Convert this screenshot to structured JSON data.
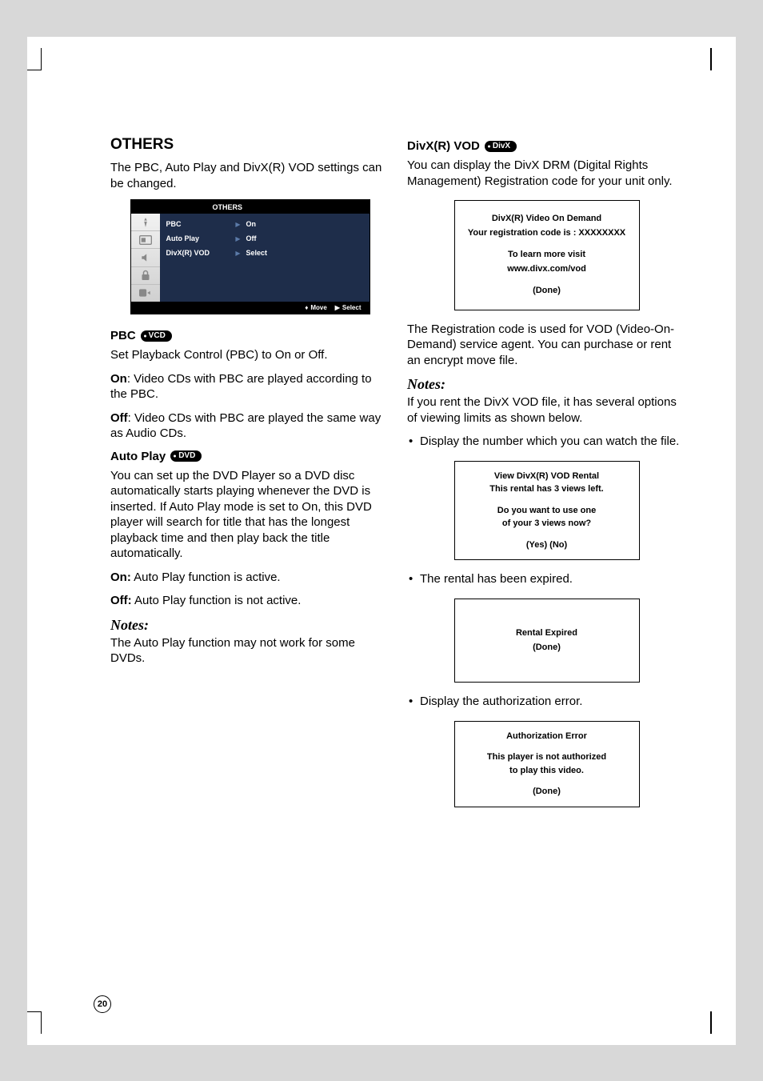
{
  "page_number": "20",
  "left": {
    "title": "OTHERS",
    "intro": "The PBC, Auto Play and DivX(R) VOD settings can be changed.",
    "osd": {
      "header": "OTHERS",
      "rows": [
        {
          "label": "PBC",
          "value": "On"
        },
        {
          "label": "Auto Play",
          "value": "Off"
        },
        {
          "label": "DivX(R) VOD",
          "value": "Select"
        }
      ],
      "footer_move": "Move",
      "footer_select": "Select"
    },
    "pbc": {
      "heading": "PBC",
      "badge": "VCD",
      "desc": "Set Playback Control (PBC) to On or Off.",
      "on_label": "On",
      "on_text": ": Video CDs with PBC are played according to the PBC.",
      "off_label": "Off",
      "off_text": ": Video CDs with PBC are played the same way as Audio CDs."
    },
    "autoplay": {
      "heading": "Auto Play",
      "badge": "DVD",
      "desc": "You can set up the DVD Player so a DVD disc automatically starts playing whenever the DVD is inserted. If Auto Play mode is set to On, this DVD player will search for title that has the longest playback time and then play back the title automatically.",
      "on_label": "On:",
      "on_text": " Auto Play function is active.",
      "off_label": "Off:",
      "off_text": " Auto Play function is not active."
    },
    "notes_heading": "Notes:",
    "notes_text": "The Auto Play function may not work for some DVDs."
  },
  "right": {
    "divx": {
      "heading": "DivX(R) VOD",
      "badge": "DivX",
      "intro": "You can display the DivX DRM (Digital Rights Management) Registration code for your unit only."
    },
    "reg_box": {
      "line1": "DivX(R) Video On Demand",
      "line2": "Your registration code is : XXXXXXXX",
      "line3": "To learn more visit",
      "line4": "www.divx.com/vod",
      "done": "(Done)"
    },
    "reg_text": "The Registration code is used for VOD (Video-On-Demand) service agent. You can purchase or rent an encrypt move file.",
    "notes_heading": "Notes:",
    "notes_text": "If you rent the DivX VOD file, it has several options of viewing limits as shown below.",
    "bullet1": "Display the number which you can watch the file.",
    "rental_box": {
      "line1": "View DivX(R) VOD Rental",
      "line2": "This rental has 3 views left.",
      "line3": "Do you want to use one",
      "line4": "of your 3 views now?",
      "yesno": "(Yes) (No)"
    },
    "bullet2": "The rental has been expired.",
    "expired_box": {
      "line1": "Rental Expired",
      "done": "(Done)"
    },
    "bullet3": "Display the authorization error.",
    "auth_box": {
      "line1": "Authorization Error",
      "line2": "This player is not authorized",
      "line3": "to play this video.",
      "done": "(Done)"
    }
  }
}
